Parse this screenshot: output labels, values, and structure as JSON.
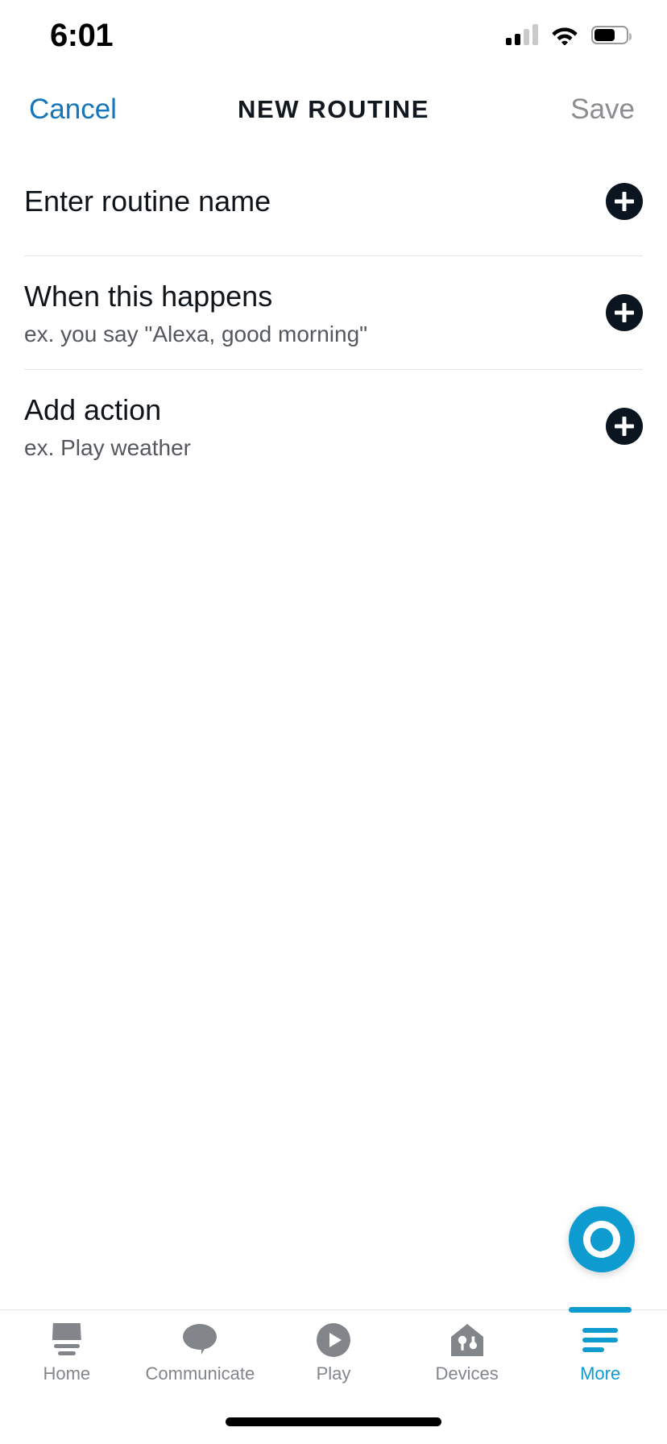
{
  "status_bar": {
    "time": "6:01",
    "signal_icon": "cellular-signal-icon",
    "signal_bars_filled": 2,
    "signal_bars_total": 4,
    "wifi_icon": "wifi-icon",
    "battery_icon": "battery-icon",
    "battery_level_percent": 60
  },
  "nav": {
    "cancel_label": "Cancel",
    "title": "NEW ROUTINE",
    "save_label": "Save",
    "cancel_color": "#1675bb",
    "save_color": "#8c8c91"
  },
  "rows": [
    {
      "name": "routine-name",
      "title": "Enter routine name",
      "subtitle": "",
      "add_icon": "plus-icon"
    },
    {
      "name": "when-this-happens",
      "title": "When this happens",
      "subtitle": "ex. you say \"Alexa, good morning\"",
      "add_icon": "plus-icon"
    },
    {
      "name": "add-action",
      "title": "Add action",
      "subtitle": "ex. Play weather",
      "add_icon": "plus-icon"
    }
  ],
  "alexa_button": {
    "icon": "alexa-logo-icon",
    "color": "#0e9cd0"
  },
  "tab_bar": {
    "active_index": 4,
    "active_color": "#0e9cd0",
    "inactive_color": "#82868b",
    "items": [
      {
        "label": "Home",
        "icon": "echo-device-icon"
      },
      {
        "label": "Communicate",
        "icon": "speech-bubble-icon"
      },
      {
        "label": "Play",
        "icon": "play-circle-icon"
      },
      {
        "label": "Devices",
        "icon": "smart-home-icon"
      },
      {
        "label": "More",
        "icon": "hamburger-menu-icon"
      }
    ]
  }
}
